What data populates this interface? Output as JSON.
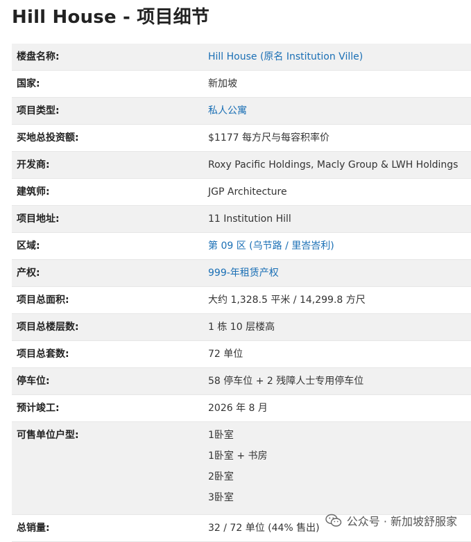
{
  "title": "Hill House - 项目细节",
  "rows": [
    {
      "label": "楼盘名称:",
      "value": "Hill House (原名 Institution Ville)"
    },
    {
      "label": "国家:",
      "value": "新加坡"
    },
    {
      "label": "项目类型:",
      "value": "私人公寓"
    },
    {
      "label": "买地总投资额:",
      "value": "$1177 每方尺与每容积率价"
    },
    {
      "label": "开发商:",
      "value": "Roxy Pacific Holdings, Macly Group & LWH Holdings"
    },
    {
      "label": "建筑师:",
      "value": "JGP Architecture"
    },
    {
      "label": "项目地址:",
      "value": "11 Institution Hill"
    },
    {
      "label": "区域:",
      "value": "第 09 区 (乌节路 / 里峇峇利)"
    },
    {
      "label": "产权:",
      "value": "999-年租赁产权"
    },
    {
      "label": "项目总面积:",
      "value": "大约 1,328.5 平米 / 14,299.8 方尺"
    },
    {
      "label": "项目总楼层数:",
      "value": "1 栋 10 层楼高"
    },
    {
      "label": "项目总套数:",
      "value": "72 单位"
    },
    {
      "label": "停车位:",
      "value": "58 停车位 + 2 残障人士专用停车位"
    },
    {
      "label": "预计竣工:",
      "value": "2026 年 8 月"
    },
    {
      "label": "可售单位户型:",
      "values": [
        "1卧室",
        "1卧室 + 书房",
        "2卧室",
        "3卧室"
      ]
    },
    {
      "label": "总销量:",
      "value": "32 / 72 单位 (44% 售出)"
    }
  ],
  "watermark": "公众号 · 新加坡舒服家",
  "colors": {
    "link": "#1a6fb5",
    "row_stripe": "#f1f1f1",
    "text": "#222222"
  }
}
